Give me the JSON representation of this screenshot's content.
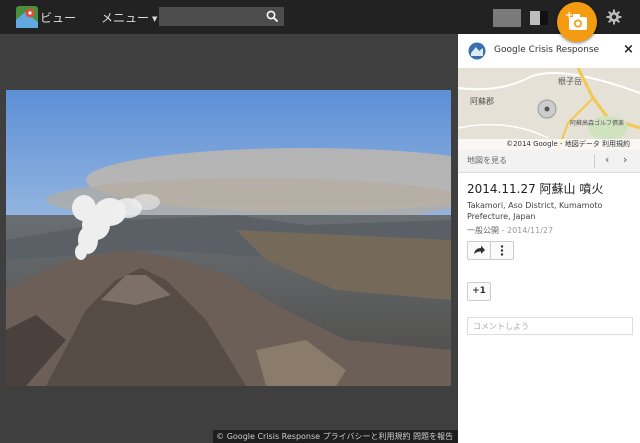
{
  "topbar": {
    "view_label": "ビュー",
    "menu_label": "メニュー",
    "search_placeholder": ""
  },
  "footer": {
    "text": "© Google Crisis Response  プライバシーと利用規約  問題を報告"
  },
  "panel": {
    "header_title": "Google Crisis Response",
    "close_label": "×",
    "map": {
      "labels": [
        "阿蘇郡",
        "根子岳",
        "阿蘇高森ゴルフ倶楽"
      ],
      "credit": "©2014 Google - 地図データ  利用規約"
    },
    "view_map_label": "地図を見る",
    "photo_title": "2014.11.27 阿蘇山 噴火",
    "location": "Takamori, Aso District, Kumamoto Prefecture, Japan",
    "visibility": "一般公開",
    "date": " - 2014/11/27",
    "plus_one_label": "+1",
    "comment_placeholder": "コメントしよう"
  },
  "colors": {
    "topbar": "#222222",
    "accent": "#f39c12",
    "panel": "#ffffff"
  }
}
